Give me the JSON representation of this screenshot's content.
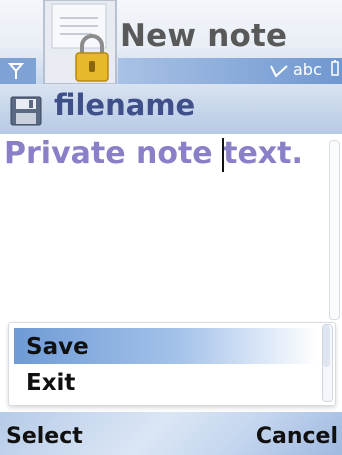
{
  "title_bar": {
    "title": "New note",
    "input_mode": "abc",
    "icons": [
      "notepad-lock-icon",
      "signal-icon",
      "edit-mode-icon",
      "battery-icon"
    ]
  },
  "filename_row": {
    "label": "filename",
    "icon": "floppy-disk-icon"
  },
  "editor": {
    "text": "Private note text."
  },
  "menu": {
    "items": [
      {
        "label": "Save",
        "selected": true
      },
      {
        "label": "Exit",
        "selected": false
      }
    ]
  },
  "softkeys": {
    "left": "Select",
    "right": "Cancel"
  },
  "colors": {
    "title_text": "#595959",
    "filename_text": "#3f4f8a",
    "note_text": "#8a80c8",
    "selection": "#6e9bd6",
    "status_strip": "#6f97d0"
  }
}
